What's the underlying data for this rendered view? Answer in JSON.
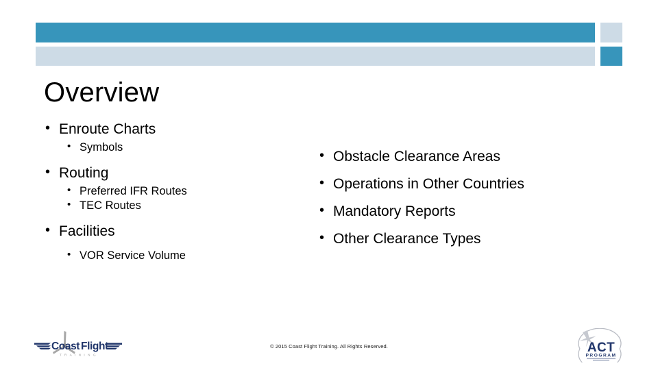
{
  "slide": {
    "title": "Overview",
    "theme": {
      "accent_dark": "#3795BB",
      "accent_light": "#CDDBE6",
      "text": "#000000",
      "logo_navy": "#21366B",
      "logo_gray": "#9A9A9A"
    }
  },
  "header": {
    "bars": [
      {
        "name": "bar-dark-main",
        "color": "#3795BB"
      },
      {
        "name": "bar-light-main",
        "color": "#CDDBE6"
      },
      {
        "name": "bar-light-accent",
        "color": "#CDDBE6"
      },
      {
        "name": "bar-dark-accent",
        "color": "#3795BB"
      }
    ]
  },
  "content": {
    "left_column": [
      {
        "level": 1,
        "text": "Enroute Charts"
      },
      {
        "level": 2,
        "text": "Symbols"
      },
      {
        "level": 1,
        "text": "Routing"
      },
      {
        "level": 2,
        "text": "Preferred IFR Routes"
      },
      {
        "level": 2,
        "text": "TEC Routes"
      },
      {
        "level": 1,
        "text": "Facilities"
      },
      {
        "level": 2,
        "text": "VOR Service Volume"
      }
    ],
    "right_column": [
      {
        "level": 1,
        "text": "Obstacle Clearance Areas"
      },
      {
        "level": 1,
        "text": "Operations in Other Countries"
      },
      {
        "level": 1,
        "text": "Mandatory Reports"
      },
      {
        "level": 1,
        "text": "Other Clearance Types"
      }
    ]
  },
  "footer": {
    "copyright": "© 2015 Coast Flight Training. All Rights Reserved.",
    "logo_left": {
      "name": "coast-flight-training-logo",
      "wordmark_primary": "Coast",
      "wordmark_secondary": "Flight",
      "tagline": "T R A I N I N G"
    },
    "logo_right": {
      "name": "act-program-logo",
      "wordmark": "ACT",
      "subtitle": "PROGRAM"
    }
  }
}
